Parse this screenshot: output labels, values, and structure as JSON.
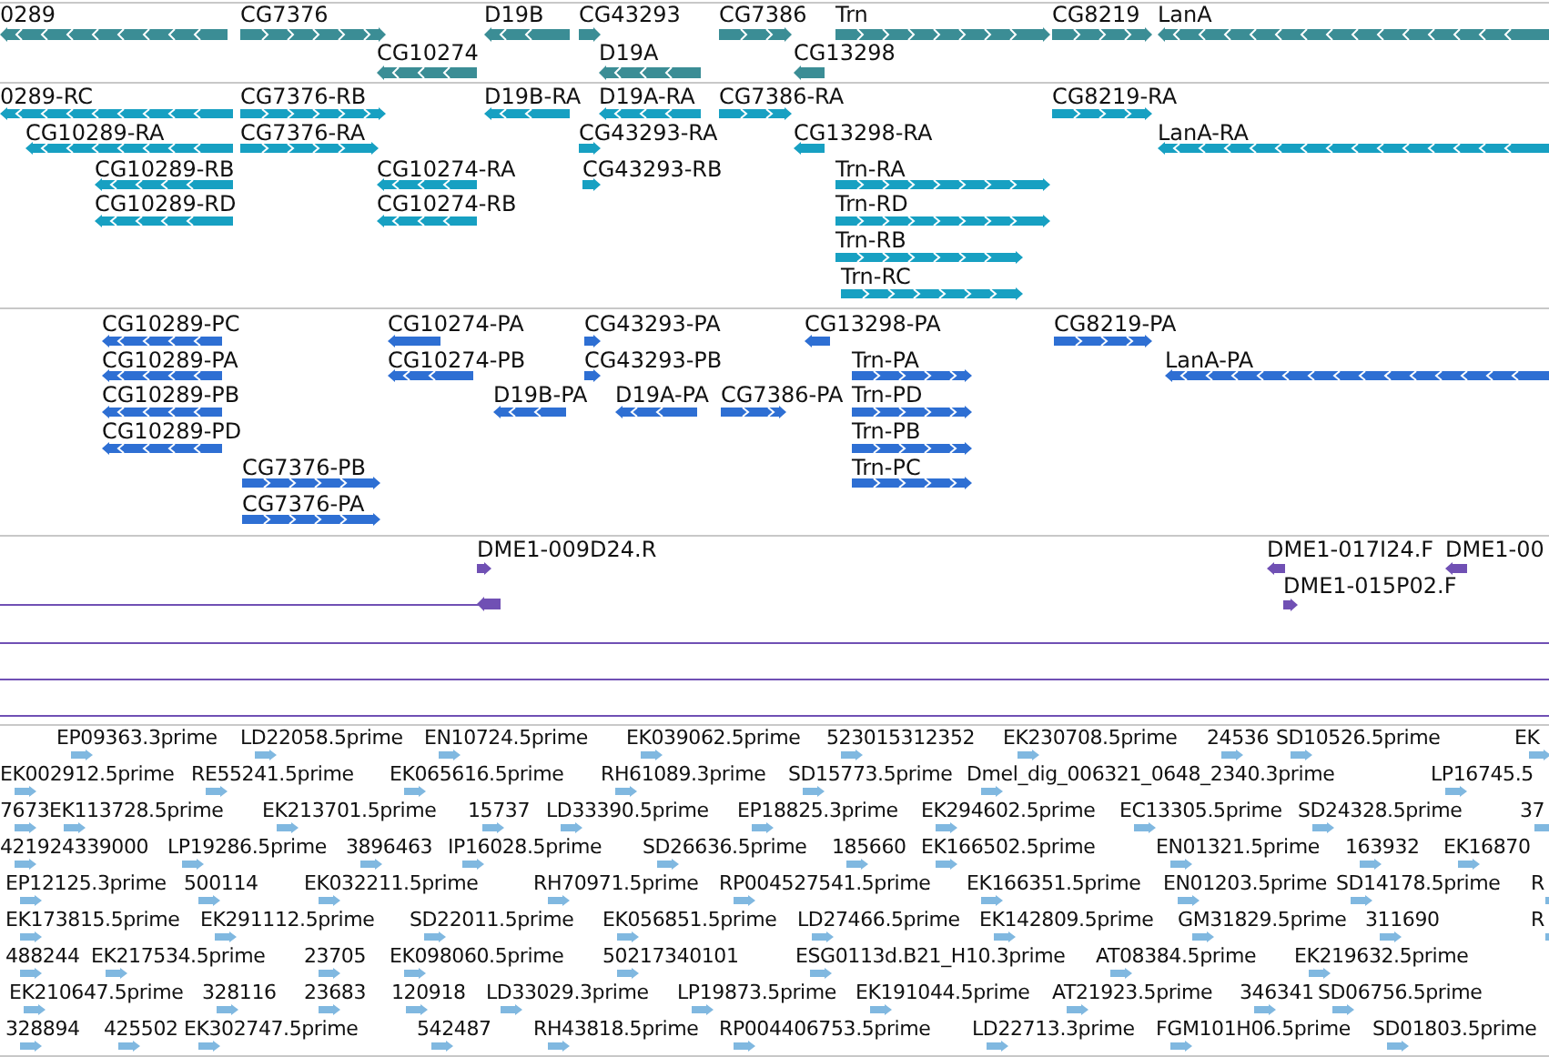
{
  "tracks": [
    {
      "kind": "gene",
      "features": [
        {
          "label": "0289",
          "reverse": true
        },
        {
          "label": "CG7376",
          "reverse": false
        },
        {
          "label": "D19B",
          "reverse": true
        },
        {
          "label": "CG43293",
          "reverse": false
        },
        {
          "label": "CG7386",
          "reverse": false
        },
        {
          "label": "Trn",
          "reverse": false
        },
        {
          "label": "CG8219",
          "reverse": false
        },
        {
          "label": "LanA",
          "reverse": true
        },
        {
          "label": "CG10274",
          "reverse": true
        },
        {
          "label": "D19A",
          "reverse": true
        },
        {
          "label": "CG13298",
          "reverse": true
        }
      ]
    },
    {
      "kind": "transcript",
      "features": [
        {
          "label": "0289-RC",
          "reverse": true
        },
        {
          "label": "CG7376-RB",
          "reverse": false
        },
        {
          "label": "D19B-RA",
          "reverse": true
        },
        {
          "label": "D19A-RA",
          "reverse": true
        },
        {
          "label": "CG7386-RA",
          "reverse": false
        },
        {
          "label": "CG8219-RA",
          "reverse": false
        },
        {
          "label": "CG10289-RA",
          "reverse": true
        },
        {
          "label": "CG7376-RA",
          "reverse": false
        },
        {
          "label": "CG43293-RA",
          "reverse": false
        },
        {
          "label": "CG13298-RA",
          "reverse": true
        },
        {
          "label": "LanA-RA",
          "reverse": true
        },
        {
          "label": "CG10289-RB",
          "reverse": true
        },
        {
          "label": "CG10274-RA",
          "reverse": true
        },
        {
          "label": "CG43293-RB",
          "reverse": false
        },
        {
          "label": "Trn-RA",
          "reverse": false
        },
        {
          "label": "CG10289-RD",
          "reverse": true
        },
        {
          "label": "CG10274-RB",
          "reverse": true
        },
        {
          "label": "Trn-RD",
          "reverse": false
        },
        {
          "label": "Trn-RB",
          "reverse": false
        },
        {
          "label": "Trn-RC",
          "reverse": false
        }
      ]
    },
    {
      "kind": "protein",
      "features": [
        {
          "label": "CG10289-PC",
          "reverse": true
        },
        {
          "label": "CG10274-PA",
          "reverse": true
        },
        {
          "label": "CG43293-PA",
          "reverse": false
        },
        {
          "label": "CG13298-PA",
          "reverse": true
        },
        {
          "label": "CG8219-PA",
          "reverse": false
        },
        {
          "label": "CG10289-PA",
          "reverse": true
        },
        {
          "label": "CG10274-PB",
          "reverse": true
        },
        {
          "label": "CG43293-PB",
          "reverse": false
        },
        {
          "label": "Trn-PA",
          "reverse": false
        },
        {
          "label": "LanA-PA",
          "reverse": true
        },
        {
          "label": "CG10289-PB",
          "reverse": true
        },
        {
          "label": "D19B-PA",
          "reverse": true
        },
        {
          "label": "D19A-PA",
          "reverse": true
        },
        {
          "label": "CG7386-PA",
          "reverse": false
        },
        {
          "label": "Trn-PD",
          "reverse": false
        },
        {
          "label": "CG10289-PD",
          "reverse": true
        },
        {
          "label": "Trn-PB",
          "reverse": false
        },
        {
          "label": "CG7376-PB",
          "reverse": false
        },
        {
          "label": "Trn-PC",
          "reverse": false
        },
        {
          "label": "CG7376-PA",
          "reverse": false
        }
      ]
    },
    {
      "kind": "clone",
      "features": [
        {
          "kind": "feature",
          "label": "DME1-009D24.R",
          "reverse": false
        },
        {
          "kind": "feature",
          "label": "DME1-017I24.F",
          "reverse": true
        },
        {
          "kind": "feature",
          "label": "DME1-00",
          "reverse": true
        },
        {
          "kind": "span",
          "reverse": true
        },
        {
          "kind": "feature",
          "label": "DME1-015P02.F",
          "reverse": false
        },
        {
          "kind": "span"
        },
        {
          "kind": "span"
        },
        {
          "kind": "span"
        }
      ]
    },
    {
      "kind": "est",
      "features": [
        {
          "label": "EP09363.3prime"
        },
        {
          "label": "LD22058.5prime"
        },
        {
          "label": "EN10724.5prime"
        },
        {
          "label": "EK039062.5prime"
        },
        {
          "label": "523015312352"
        },
        {
          "label": "EK230708.5prime"
        },
        {
          "label": "24536"
        },
        {
          "label": "SD10526.5prime"
        },
        {
          "label": "EK"
        },
        {
          "label": "EK002912.5prime"
        },
        {
          "label": "RE55241.5prime"
        },
        {
          "label": "EK065616.5prime"
        },
        {
          "label": "RH61089.3prime"
        },
        {
          "label": "SD15773.5prime"
        },
        {
          "label": "Dmel_dig_006321_0648_2340.3prime"
        },
        {
          "label": "LP16745.5"
        },
        {
          "label": "7673"
        },
        {
          "label": "EK113728.5prime"
        },
        {
          "label": "EK213701.5prime"
        },
        {
          "label": "15737"
        },
        {
          "label": "LD33390.5prime"
        },
        {
          "label": "EP18825.3prime"
        },
        {
          "label": "EK294602.5prime"
        },
        {
          "label": "EC13305.5prime"
        },
        {
          "label": "SD24328.5prime"
        },
        {
          "label": "37"
        },
        {
          "label": "421924339000"
        },
        {
          "label": "LP19286.5prime"
        },
        {
          "label": "3896463"
        },
        {
          "label": "IP16028.5prime"
        },
        {
          "label": "SD26636.5prime"
        },
        {
          "label": "185660"
        },
        {
          "label": "EK166502.5prime"
        },
        {
          "label": "EN01321.5prime"
        },
        {
          "label": "163932"
        },
        {
          "label": "EK16870"
        },
        {
          "label": "EP12125.3prime"
        },
        {
          "label": "500114"
        },
        {
          "label": "EK032211.5prime"
        },
        {
          "label": "RH70971.5prime"
        },
        {
          "label": "RP004527541.5prime"
        },
        {
          "label": "EK166351.5prime"
        },
        {
          "label": "EN01203.5prime"
        },
        {
          "label": "SD14178.5prime"
        },
        {
          "label": "R"
        },
        {
          "label": "EK173815.5prime"
        },
        {
          "label": "EK291112.5prime"
        },
        {
          "label": "SD22011.5prime"
        },
        {
          "label": "EK056851.5prime"
        },
        {
          "label": "LD27466.5prime"
        },
        {
          "label": "EK142809.5prime"
        },
        {
          "label": "GM31829.5prime"
        },
        {
          "label": "311690"
        },
        {
          "label": "R"
        },
        {
          "label": "488244"
        },
        {
          "label": "EK217534.5prime"
        },
        {
          "label": "23705"
        },
        {
          "label": "EK098060.5prime"
        },
        {
          "label": "50217340101"
        },
        {
          "label": "ESG0113d.B21_H10.3prime"
        },
        {
          "label": "AT08384.5prime"
        },
        {
          "label": "EK219632.5prime"
        },
        {
          "label": "EK210647.5prime"
        },
        {
          "label": "328116"
        },
        {
          "label": "23683"
        },
        {
          "label": "120918"
        },
        {
          "label": "LD33029.3prime"
        },
        {
          "label": "LP19873.5prime"
        },
        {
          "label": "EK191044.5prime"
        },
        {
          "label": "AT21923.5prime"
        },
        {
          "label": "346341"
        },
        {
          "label": "SD06756.5prime"
        },
        {
          "label": "328894"
        },
        {
          "label": "425502"
        },
        {
          "label": "EK302747.5prime"
        },
        {
          "label": "542487"
        },
        {
          "label": "RH43818.5prime"
        },
        {
          "label": "RP004406753.5prime"
        },
        {
          "label": "LD22713.3prime"
        },
        {
          "label": "FGM101H06.5prime"
        },
        {
          "label": "SD01803.5prime"
        }
      ]
    }
  ]
}
